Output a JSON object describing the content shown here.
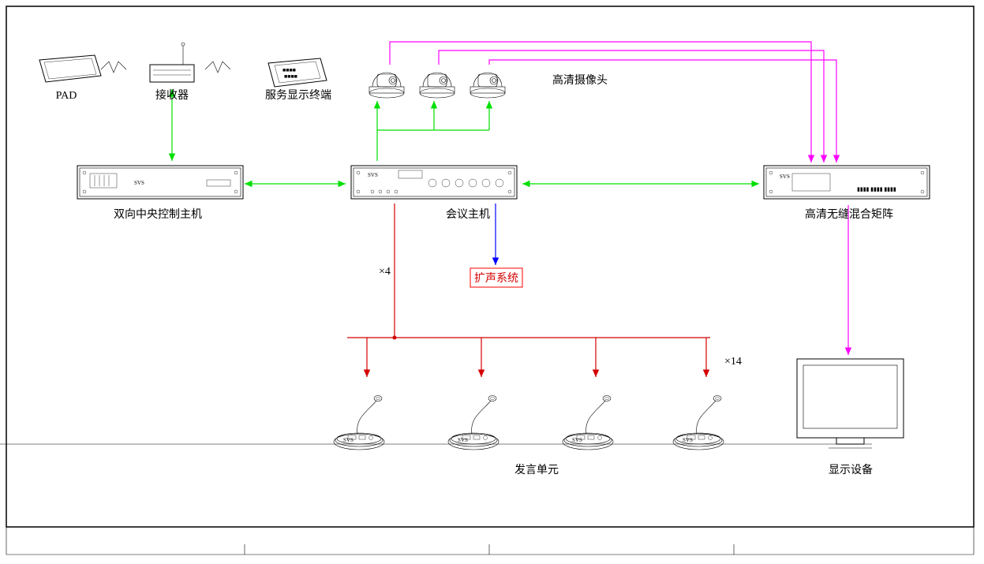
{
  "labels": {
    "pad": "PAD",
    "receiver": "接收器",
    "service_terminal": "服务显示终端",
    "camera": "高清摄像头",
    "central_host": "双向中央控制主机",
    "conf_host": "会议主机",
    "matrix": "高清无缝混合矩阵",
    "pa": "扩声系统",
    "speak_unit": "发言单元",
    "display": "显示设备",
    "x4": "×4",
    "x14": "×14",
    "brand": "SVS"
  }
}
